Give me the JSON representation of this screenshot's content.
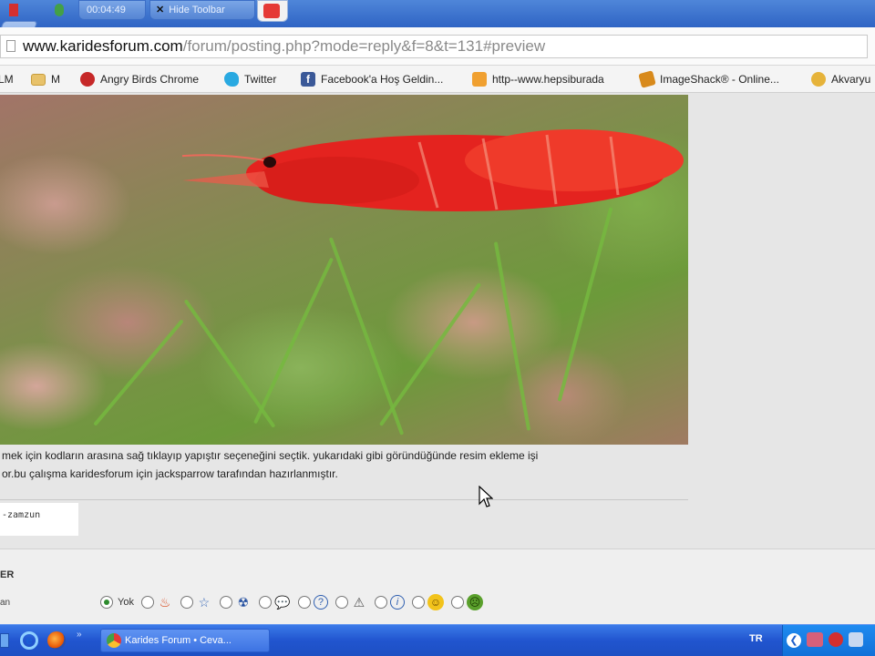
{
  "browser": {
    "tabs": [
      {
        "label": "00:04:49"
      },
      {
        "label": "Hide Toolbar"
      }
    ],
    "url_host": "www.karidesforum.com",
    "url_path": "/forum/posting.php?mode=reply&f=8&t=131#preview"
  },
  "bookmarks": [
    {
      "label": "LM",
      "icon": "blank-page-icon"
    },
    {
      "label": "M",
      "icon": "folder-icon"
    },
    {
      "label": "Angry Birds Chrome",
      "icon": "angry-bird-icon"
    },
    {
      "label": "Twitter",
      "icon": "twitter-bird-icon"
    },
    {
      "label": "Facebook'a Hoş Geldin...",
      "icon": "facebook-icon"
    },
    {
      "label": "http--www.hepsiburada",
      "icon": "image-icon"
    },
    {
      "label": "ImageShack® - Online...",
      "icon": "imageshack-icon"
    },
    {
      "label": "Akvaryu",
      "icon": "smiley-icon"
    }
  ],
  "post": {
    "line1": "mek için kodların arasına sağ tıklayıp yapıştır seçeneğini seçtik. yukarıdaki gibi göründüğünde resim ekleme işi",
    "line2": "or.bu çalışma karidesforum için jacksparrow tarafından hazırlanmıştır.",
    "signature": "-zamzun"
  },
  "panel": {
    "heading": "ER",
    "row_label": "an",
    "none_label": "Yok",
    "icons": [
      "flame-icon",
      "star-icon",
      "radioactive-icon",
      "speech-bubble-icon",
      "question-icon",
      "warning-icon",
      "info-icon",
      "smiley-icon",
      "frown-icon"
    ]
  },
  "taskbar": {
    "task_label": "Karides Forum • Ceva...",
    "language": "TR"
  },
  "colors": {
    "accent": "#2155cf",
    "shrimp": "#e4231f"
  }
}
